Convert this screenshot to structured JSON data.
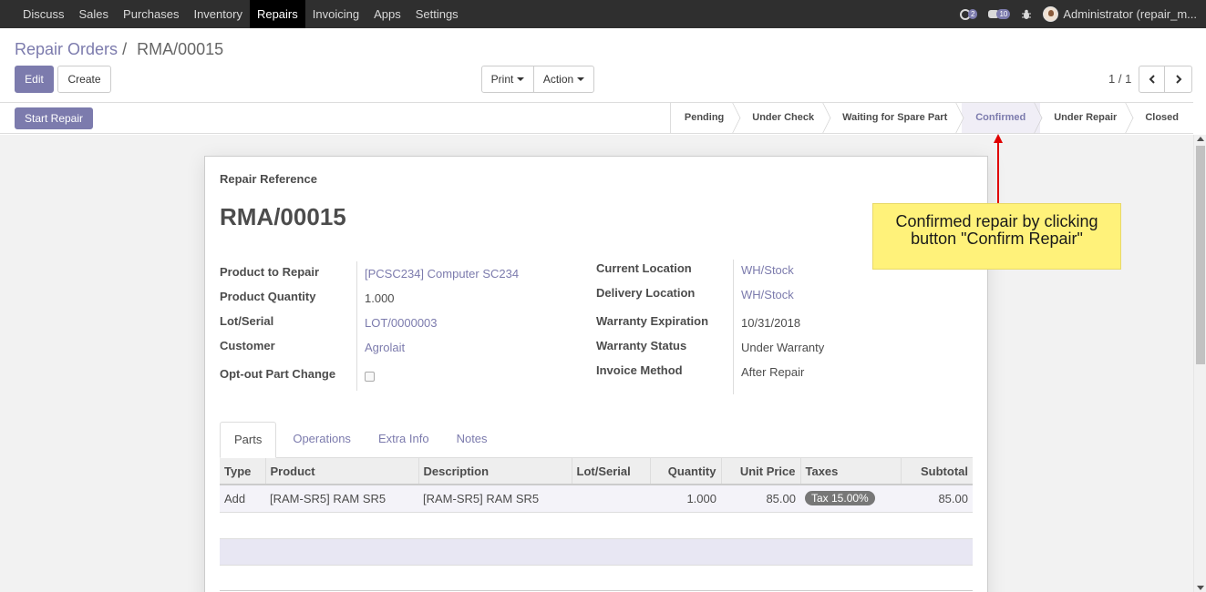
{
  "topbar": {
    "menu": [
      "Discuss",
      "Sales",
      "Purchases",
      "Inventory",
      "Repairs",
      "Invoicing",
      "Apps",
      "Settings"
    ],
    "active": "Repairs",
    "activity_count": "2",
    "message_count": "10",
    "user": "Administrator (repair_m..."
  },
  "breadcrumb": {
    "parent": "Repair Orders",
    "separator": "/",
    "current": "RMA/00015"
  },
  "buttons": {
    "edit": "Edit",
    "create": "Create",
    "print": "Print",
    "action": "Action",
    "start_repair": "Start Repair"
  },
  "pager": {
    "value": "1 / 1"
  },
  "statusbar": {
    "stages": [
      "Pending",
      "Under Check",
      "Waiting for Spare Part",
      "Confirmed",
      "Under Repair",
      "Closed"
    ],
    "current": "Confirmed"
  },
  "form": {
    "ref_label": "Repair Reference",
    "ref_value": "RMA/00015",
    "left": [
      {
        "label": "Product to Repair",
        "value": "[PCSC234] Computer SC234",
        "link": true
      },
      {
        "label": "Product Quantity",
        "value": "1.000",
        "link": false
      },
      {
        "label": "Lot/Serial",
        "value": "LOT/0000003",
        "link": true
      },
      {
        "label": "Customer",
        "value": "Agrolait",
        "link": true
      },
      {
        "label": "Opt-out Part Change",
        "value": "",
        "link": false
      }
    ],
    "right": [
      {
        "label": "Current Location",
        "value": "WH/Stock",
        "link": true
      },
      {
        "label": "Delivery Location",
        "value": "WH/Stock",
        "link": true
      },
      {
        "label": "Warranty Expiration",
        "value": "10/31/2018",
        "link": false
      },
      {
        "label": "Warranty Status",
        "value": "Under Warranty",
        "link": false
      },
      {
        "label": "Invoice Method",
        "value": "After Repair",
        "link": false
      }
    ]
  },
  "tabs": [
    "Parts",
    "Operations",
    "Extra Info",
    "Notes"
  ],
  "table": {
    "columns": [
      "Type",
      "Product",
      "Description",
      "Lot/Serial",
      "Quantity",
      "Unit Price",
      "Taxes",
      "Subtotal"
    ],
    "rows": [
      {
        "type": "Add",
        "product": "[RAM-SR5] RAM SR5",
        "description": "[RAM-SR5] RAM SR5",
        "lot": "",
        "quantity": "1.000",
        "unit_price": "85.00",
        "taxes": "Tax 15.00%",
        "subtotal": "85.00"
      }
    ]
  },
  "annotation": {
    "text": "Confirmed repair by clicking button \"Confirm Repair\""
  },
  "colors": {
    "primary": "#7c7bad",
    "topbar": "#2f2f2f",
    "note": "#fff27a",
    "arrow": "#e00000"
  }
}
